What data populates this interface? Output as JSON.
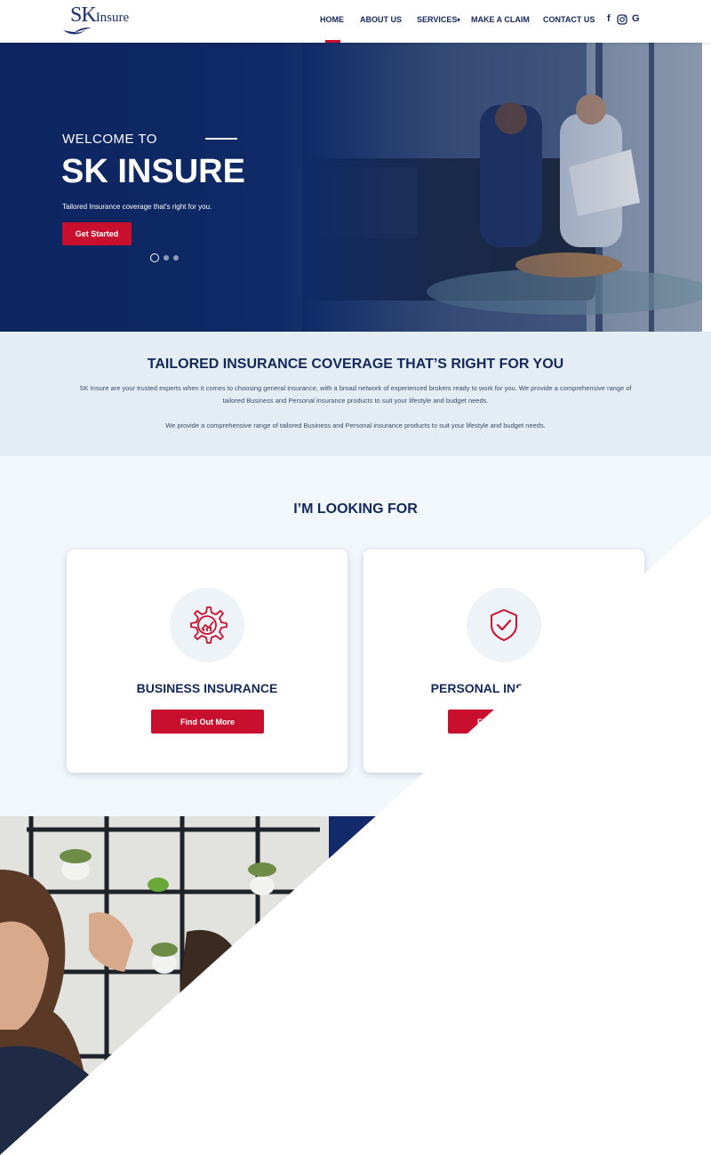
{
  "nav": {
    "logo_text_big": "SK",
    "logo_text_small": "Insure",
    "links": [
      "HOME",
      "ABOUT US",
      "SERVICES",
      "MAKE A CLAIM",
      "CONTACT US"
    ],
    "social": [
      "facebook-icon",
      "instagram-icon",
      "google-icon"
    ],
    "facebook_glyph": "f",
    "google_glyph": "G",
    "accent": "#c8102e"
  },
  "hero": {
    "welcome": "WELCOME TO",
    "title": "SK INSURE",
    "subtitle": "Tailored Insurance coverage that's right for you.",
    "cta": "Get Started",
    "background": "#0f2a66"
  },
  "intro": {
    "heading": "TAILORED INSURANCE COVERAGE THAT’S RIGHT FOR YOU",
    "para1": "SK Insure are your trusted experts when it comes to choosing general insurance, with a broad network of experienced brokers ready to work for you. We provide a comprehensive range of tailored Business and Personal insurance products to suit your lifestyle and budget needs.",
    "para2": "We provide a comprehensive range of tailored Business and Personal insurance products to suit your lifestyle and budget needs."
  },
  "looking": {
    "heading": "I’M LOOKING FOR",
    "cards": [
      {
        "title": "BUSINESS INSURANCE",
        "button": "Find Out More",
        "icon": "gear-chart-icon"
      },
      {
        "title": "PERSONAL INSURANCE",
        "button": "Find Out More",
        "icon": "shield-check-icon"
      }
    ]
  }
}
